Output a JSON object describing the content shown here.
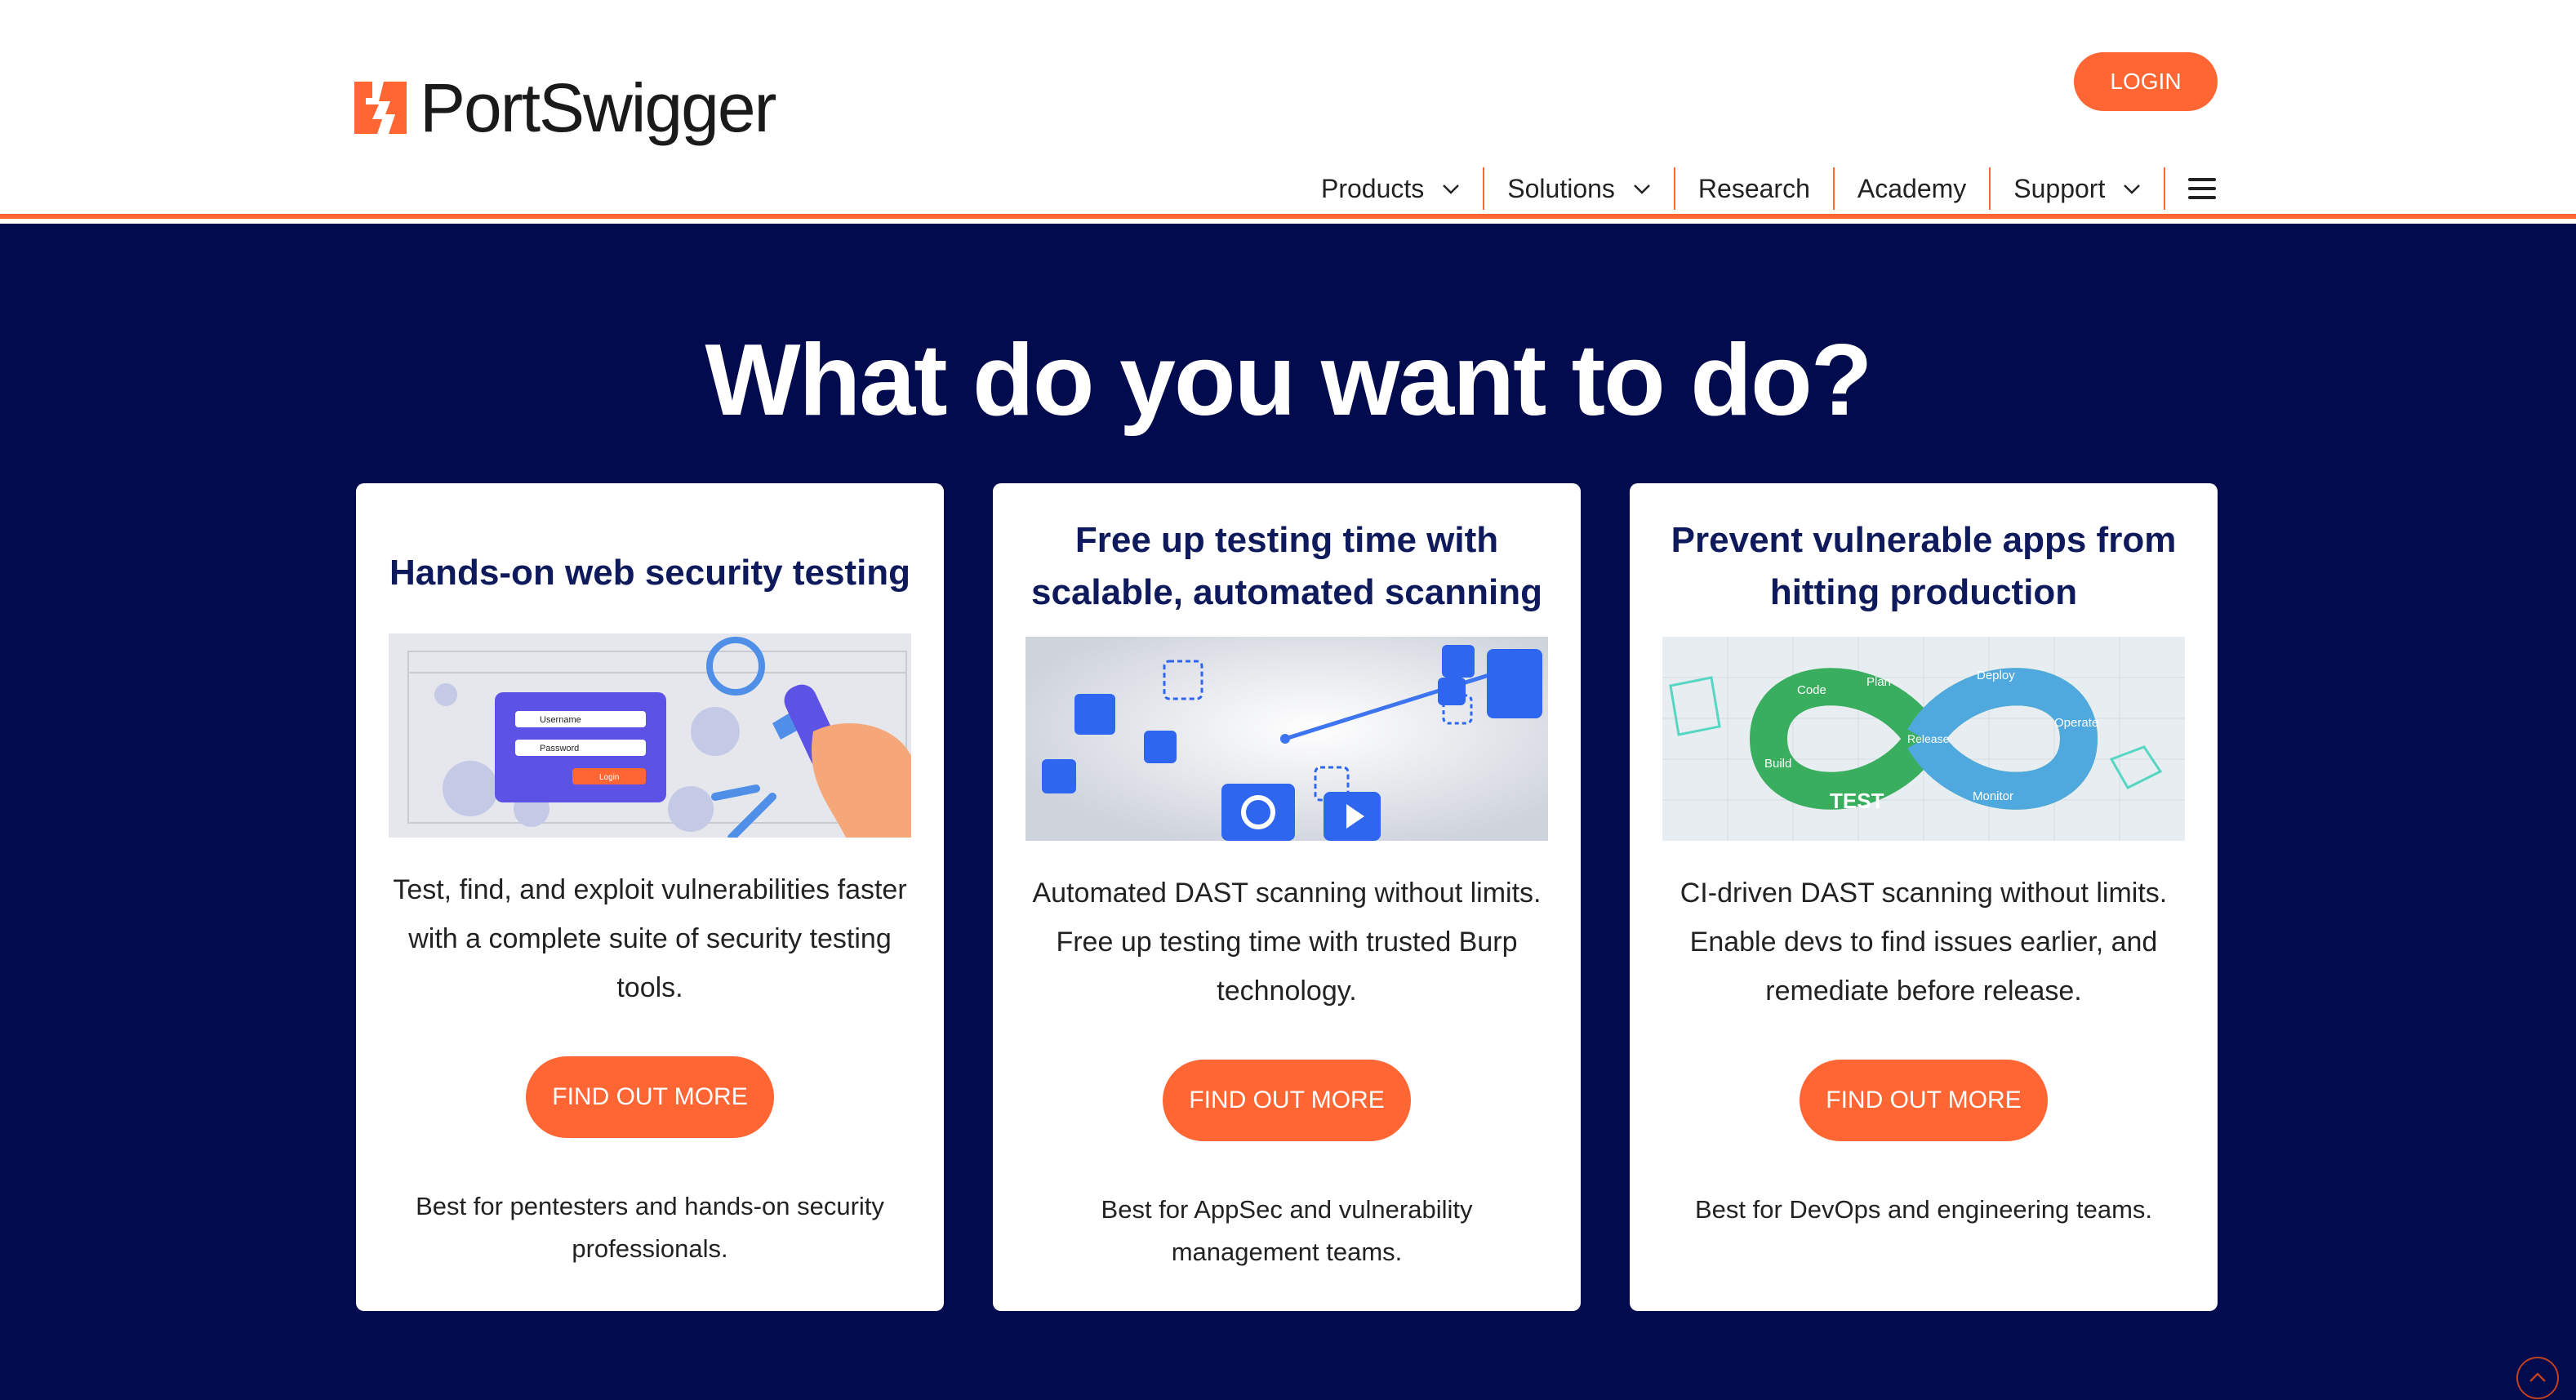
{
  "header": {
    "brand": "PortSwigger",
    "login_label": "LOGIN",
    "nav": [
      {
        "label": "Products",
        "dropdown": true
      },
      {
        "label": "Solutions",
        "dropdown": true
      },
      {
        "label": "Research",
        "dropdown": false
      },
      {
        "label": "Academy",
        "dropdown": false
      },
      {
        "label": "Support",
        "dropdown": true
      }
    ],
    "menu_icon": "hamburger-menu-icon"
  },
  "hero": {
    "title": "What do you want to do?"
  },
  "cards": [
    {
      "title": "Hands-on web security testing",
      "image_labels": {
        "username": "Username",
        "password": "Password",
        "login": "Login"
      },
      "description": "Test, find, and exploit vulnerabilities faster with a complete suite of security testing tools.",
      "button": "FIND OUT MORE",
      "note": "Best for pentesters and hands-on security professionals."
    },
    {
      "title": "Free up testing time with scalable, automated scanning",
      "description": "Automated DAST scanning without limits. Free up testing time with trusted Burp technology.",
      "button": "FIND OUT MORE",
      "note": "Best for AppSec and vulnerability management teams."
    },
    {
      "title": "Prevent vulnerable apps from hitting production",
      "image_labels": {
        "code": "Code",
        "plan": "Plan",
        "build": "Build",
        "test": "TEST",
        "release": "Release",
        "deploy": "Deploy",
        "operate": "Operate",
        "monitor": "Monitor"
      },
      "description": "CI-driven DAST scanning without limits. Enable devs to find issues earlier, and remediate before release.",
      "button": "FIND OUT MORE",
      "note": "Best for DevOps and engineering teams."
    }
  ],
  "colors": {
    "accent": "#ff6633",
    "hero_bg": "#010b4e",
    "card_title": "#0e1a5c"
  }
}
